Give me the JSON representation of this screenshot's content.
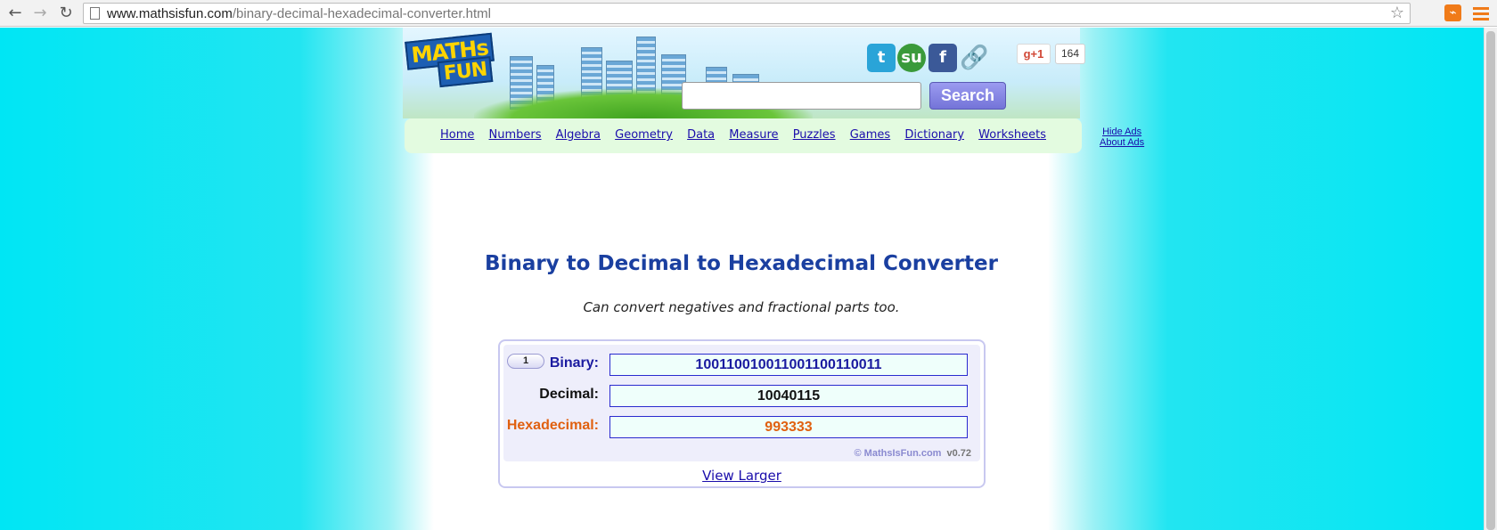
{
  "browser": {
    "url_host": "www.mathsisfun.com",
    "url_path": "/binary-decimal-hexadecimal-converter.html",
    "back_icon": "←",
    "forward_icon": "→",
    "reload_icon": "↻",
    "star_icon": "☆"
  },
  "header": {
    "logo_line1": "MATHs",
    "logo_line2": "FUN",
    "social": {
      "twitter": "t",
      "stumbleupon": "su",
      "facebook": "f",
      "link": "🔗"
    },
    "gplus_label": "g+1",
    "gplus_count": "164",
    "search_button": "Search",
    "search_value": ""
  },
  "nav": {
    "items": [
      "Home",
      "Numbers",
      "Algebra",
      "Geometry",
      "Data",
      "Measure",
      "Puzzles",
      "Games",
      "Dictionary",
      "Worksheets"
    ],
    "hide_ads": "Hide Ads",
    "about_ads": "About Ads"
  },
  "main": {
    "title": "Binary to Decimal to Hexadecimal Converter",
    "subtitle": "Can convert negatives and fractional parts too."
  },
  "converter": {
    "badge": "1",
    "binary_label": "Binary:",
    "binary_value": "100110010011001100110011",
    "decimal_label": "Decimal:",
    "decimal_value": "10040115",
    "hex_label": "Hexadecimal:",
    "hex_value": "993333",
    "credit": "© MathsIsFun.com",
    "version": "v0.72",
    "view_larger": "View Larger"
  },
  "colors": {
    "accent_blue": "#1a3fa0",
    "hex_orange": "#e06010",
    "cyan_bg": "#00e6f4",
    "nav_green": "#e3fbe0"
  }
}
